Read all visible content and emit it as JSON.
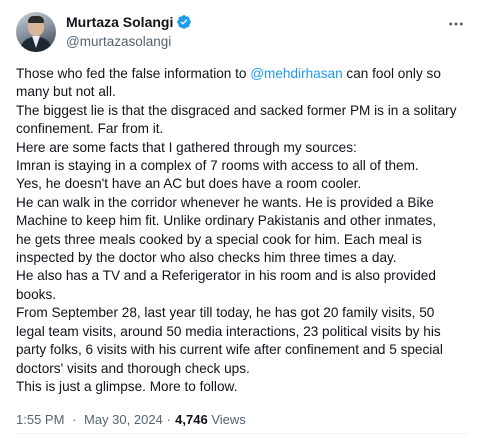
{
  "author": {
    "display_name": "Murtaza Solangi",
    "handle": "@murtazasolangi",
    "verified": true
  },
  "icons": {
    "verified": "verified-badge-icon",
    "more": "more-horizontal-icon",
    "verified_color": "#1d9bf0"
  },
  "tweet": {
    "lines": [
      {
        "before": "Those who fed the false information to ",
        "mention": "@mehdirhasan",
        "after": " can fool only so"
      },
      {
        "text": "many but not all."
      },
      {
        "text": "The biggest lie is that the disgraced and sacked former PM is in a solitary"
      },
      {
        "text": "confinement. Far from it."
      },
      {
        "text": "Here are some facts that I gathered through my sources:"
      },
      {
        "text": "Imran is staying in a complex of 7 rooms with access to all of them."
      },
      {
        "text": "Yes, he doesn't have an AC but does have a room cooler."
      },
      {
        "text": "He can walk in the corridor whenever he wants. He is provided a Bike"
      },
      {
        "text": "Machine to keep him fit. Unlike ordinary Pakistanis and other inmates,"
      },
      {
        "text": "he gets three meals cooked by a special cook for him. Each meal is"
      },
      {
        "text": "inspected by the doctor who also checks him three times a day."
      },
      {
        "text": "He also has a TV and a Referigerator in his room and is also provided"
      },
      {
        "text": "books."
      },
      {
        "text": "From September 28, last year till today, he has got 20 family visits, 50"
      },
      {
        "text": "legal team visits, around 50 media interactions, 23 political visits by his"
      },
      {
        "text": "party folks, 6 visits with his current wife after confinement and 5 special"
      },
      {
        "text": "doctors' visits and thorough check ups."
      },
      {
        "text": "This is just a glimpse. More to follow."
      }
    ]
  },
  "meta": {
    "time": "1:55 PM",
    "separator": "·",
    "date": "May 30, 2024",
    "views_count": "4,746",
    "views_label": "Views"
  }
}
